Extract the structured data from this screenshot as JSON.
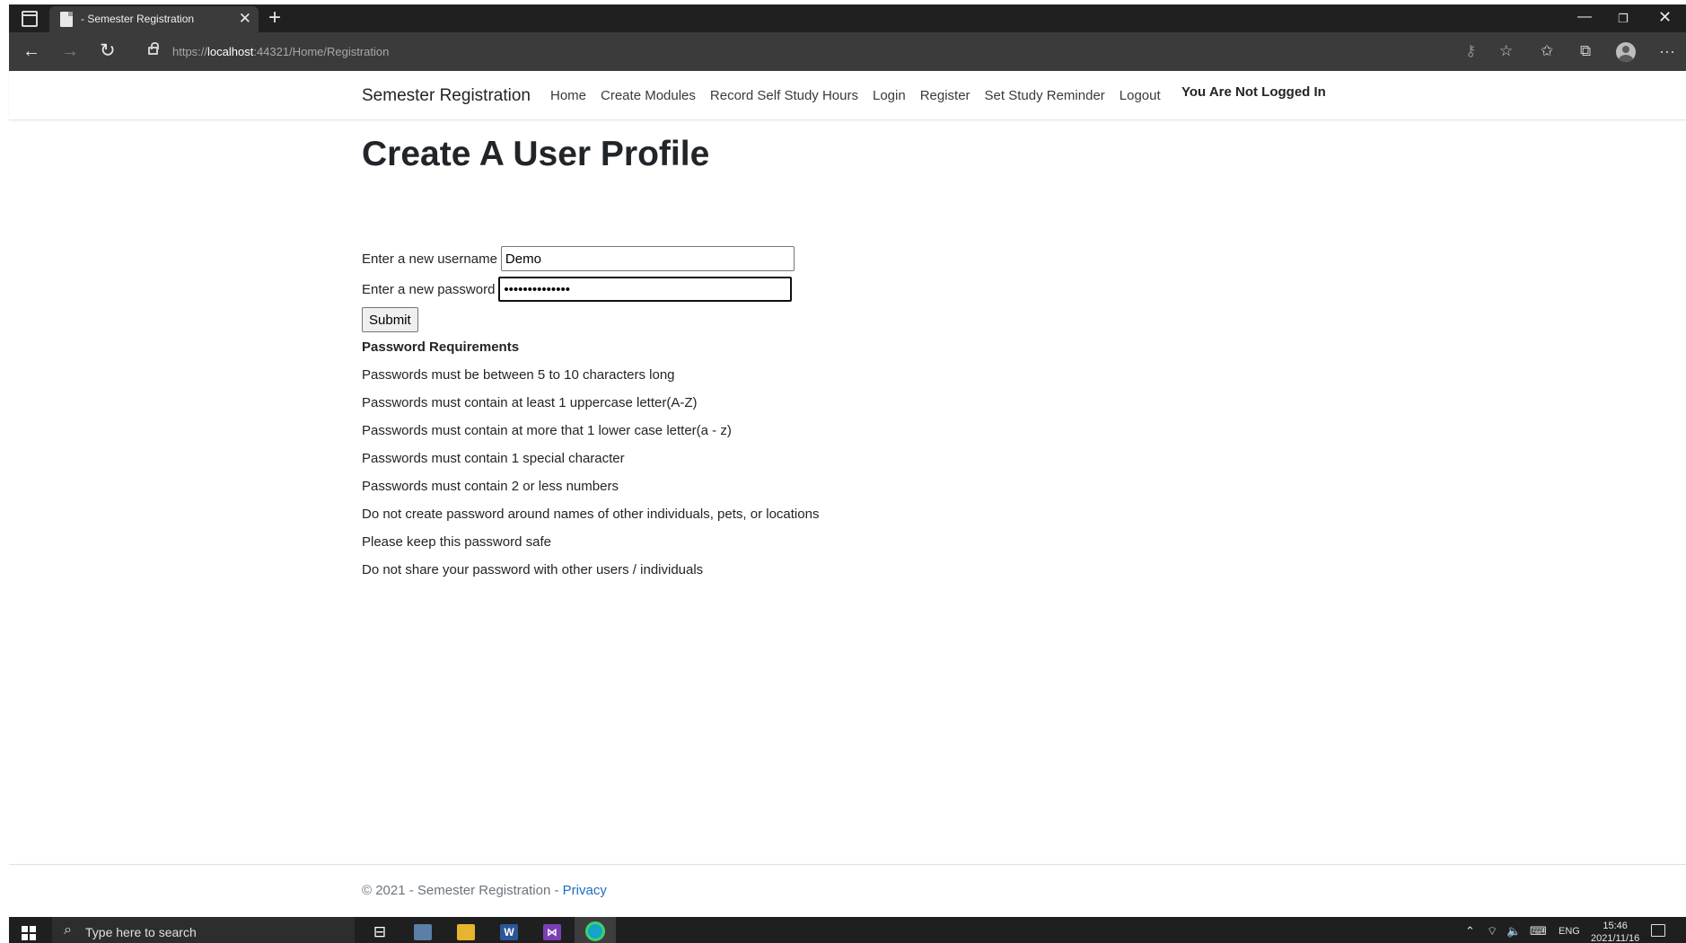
{
  "browser": {
    "tab_title": "- Semester Registration",
    "url_scheme": "https://",
    "url_host": "localhost",
    "url_rest": ":44321/Home/Registration"
  },
  "header": {
    "brand": "Semester Registration",
    "nav": [
      "Home",
      "Create Modules",
      "Record Self Study Hours",
      "Login",
      "Register",
      "Set Study Reminder",
      "Logout"
    ],
    "status": "You Are Not Logged In"
  },
  "form": {
    "title": "Create A User Profile",
    "username_label": "Enter a new username",
    "username_value": "Demo",
    "password_label": "Enter a new password",
    "password_value": "••••••••••••••",
    "submit_label": "Submit"
  },
  "requirements": {
    "heading": "Password Requirements",
    "items": [
      "Passwords must be between 5 to 10 characters long",
      "Passwords must contain at least 1 uppercase letter(A-Z)",
      "Passwords must contain at more that 1 lower case letter(a - z)",
      "Passwords must contain 1 special character",
      "Passwords must contain 2 or less numbers",
      "Do not create password around names of other individuals, pets, or locations",
      "Please keep this password safe",
      "Do not share your password with other users / individuals"
    ]
  },
  "footer": {
    "text": "© 2021 - Semester Registration - ",
    "link": "Privacy"
  },
  "taskbar": {
    "search_placeholder": "Type here to search",
    "language": "ENG",
    "time": "15:46",
    "date": "2021/11/16"
  },
  "colors": {
    "link": "#1b6ec2",
    "title_bar": "#202020",
    "address_bar": "#3b3b3b"
  },
  "icons": [
    "tab-actions-icon",
    "close-icon",
    "plus-icon",
    "back-arrow-icon",
    "forward-arrow-icon",
    "reload-icon",
    "lock-icon",
    "key-icon",
    "star-add-icon",
    "favorites-icon",
    "collections-icon",
    "profile-icon",
    "more-icon",
    "windows-start-icon",
    "search-icon"
  ]
}
